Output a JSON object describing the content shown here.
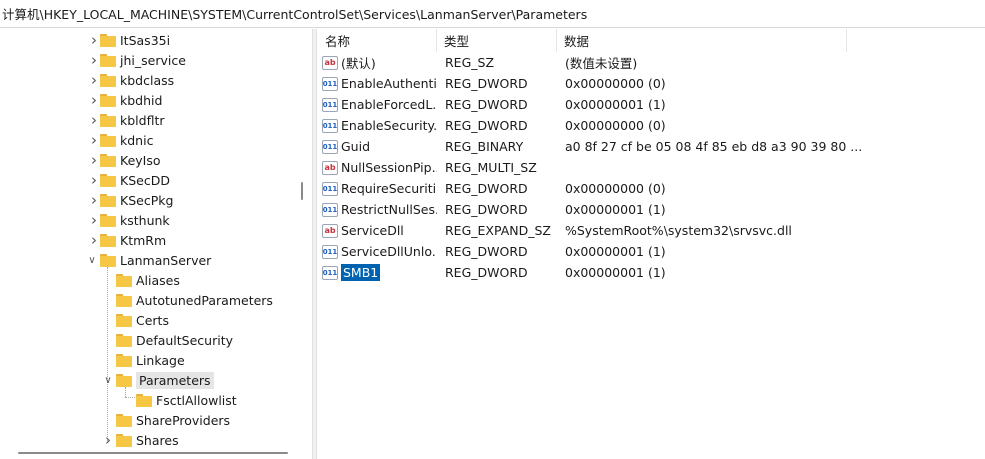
{
  "address_bar": {
    "path": "计算机\\HKEY_LOCAL_MACHINE\\SYSTEM\\CurrentControlSet\\Services\\LanmanServer\\Parameters"
  },
  "tree": {
    "items": [
      {
        "label": "ItSas35i",
        "expander": "collapsed"
      },
      {
        "label": "jhi_service",
        "expander": "collapsed"
      },
      {
        "label": "kbdclass",
        "expander": "collapsed"
      },
      {
        "label": "kbdhid",
        "expander": "collapsed"
      },
      {
        "label": "kbldfltr",
        "expander": "collapsed"
      },
      {
        "label": "kdnic",
        "expander": "collapsed"
      },
      {
        "label": "KeyIso",
        "expander": "collapsed"
      },
      {
        "label": "KSecDD",
        "expander": "collapsed"
      },
      {
        "label": "KSecPkg",
        "expander": "collapsed"
      },
      {
        "label": "ksthunk",
        "expander": "collapsed"
      },
      {
        "label": "KtmRm",
        "expander": "collapsed"
      },
      {
        "label": "LanmanServer",
        "expander": "expanded"
      },
      {
        "label": "Aliases",
        "expander": "none"
      },
      {
        "label": "AutotunedParameters",
        "expander": "none"
      },
      {
        "label": "Certs",
        "expander": "none"
      },
      {
        "label": "DefaultSecurity",
        "expander": "none"
      },
      {
        "label": "Linkage",
        "expander": "none"
      },
      {
        "label": "Parameters",
        "expander": "expanded",
        "selected": true
      },
      {
        "label": "FsctlAllowlist",
        "expander": "none"
      },
      {
        "label": "ShareProviders",
        "expander": "none"
      },
      {
        "label": "Shares",
        "expander": "collapsed"
      }
    ]
  },
  "values_list": {
    "columns": {
      "name": "名称",
      "type": "类型",
      "data": "数据"
    },
    "rows": [
      {
        "icon": "string-value-icon",
        "name": "(默认)",
        "type": "REG_SZ",
        "data": "(数值未设置)"
      },
      {
        "icon": "binary-value-icon",
        "name": "EnableAuthenti...",
        "type": "REG_DWORD",
        "data": "0x00000000 (0)"
      },
      {
        "icon": "binary-value-icon",
        "name": "EnableForcedL...",
        "type": "REG_DWORD",
        "data": "0x00000001 (1)"
      },
      {
        "icon": "binary-value-icon",
        "name": "EnableSecurity...",
        "type": "REG_DWORD",
        "data": "0x00000000 (0)"
      },
      {
        "icon": "binary-value-icon",
        "name": "Guid",
        "type": "REG_BINARY",
        "data": "a0 8f 27 cf be 05 08 4f 85 eb d8 a3 90 39 80 ..."
      },
      {
        "icon": "string-value-icon",
        "name": "NullSessionPip...",
        "type": "REG_MULTI_SZ",
        "data": ""
      },
      {
        "icon": "binary-value-icon",
        "name": "RequireSecuriti...",
        "type": "REG_DWORD",
        "data": "0x00000000 (0)"
      },
      {
        "icon": "binary-value-icon",
        "name": "RestrictNullSes...",
        "type": "REG_DWORD",
        "data": "0x00000001 (1)"
      },
      {
        "icon": "string-value-icon",
        "name": "ServiceDll",
        "type": "REG_EXPAND_SZ",
        "data": "%SystemRoot%\\system32\\srvsvc.dll"
      },
      {
        "icon": "binary-value-icon",
        "name": "ServiceDllUnlo...",
        "type": "REG_DWORD",
        "data": "0x00000001 (1)"
      },
      {
        "icon": "binary-value-icon",
        "name": "SMB1",
        "type": "REG_DWORD",
        "data": "0x00000001 (1)",
        "selected": true
      }
    ]
  }
}
